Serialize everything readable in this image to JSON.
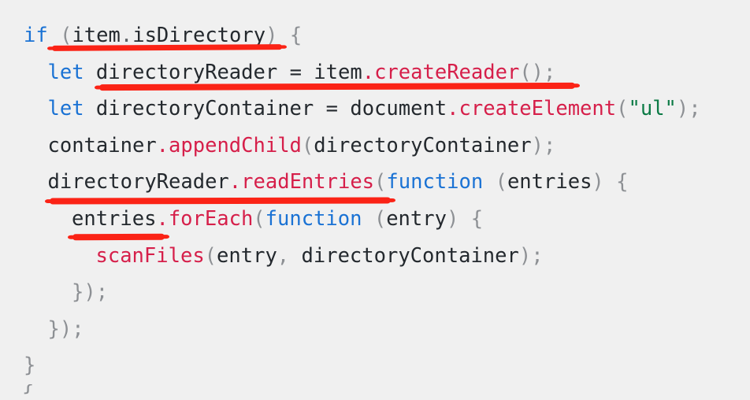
{
  "editor": {
    "background_color": "#f0f0f0",
    "language": "javascript",
    "font_size_px": 25.5
  },
  "theme_colors": {
    "keyword": "#1a72d4",
    "identifier": "#24292e",
    "method": "#d61f4a",
    "punctuation": "#8d9094",
    "string": "#0b7a45",
    "annotation_underline": "#fb2316"
  },
  "code": {
    "lines": [
      {
        "id": "line-1",
        "indent": 0,
        "plain_text": "if (item.isDirectory) {",
        "tokens": [
          {
            "t": "if",
            "k": "kw"
          },
          {
            "t": " ",
            "k": "ws"
          },
          {
            "t": "(",
            "k": "punct"
          },
          {
            "t": "item",
            "k": "ident"
          },
          {
            "t": ".",
            "k": "dot-dim"
          },
          {
            "t": "isDirectory",
            "k": "ident"
          },
          {
            "t": ")",
            "k": "punct"
          },
          {
            "t": " ",
            "k": "ws"
          },
          {
            "t": "{",
            "k": "punct"
          }
        ]
      },
      {
        "id": "line-2",
        "indent": 1,
        "plain_text": "let directoryReader = item.createReader();",
        "tokens": [
          {
            "t": "let",
            "k": "kw"
          },
          {
            "t": " ",
            "k": "ws"
          },
          {
            "t": "directoryReader",
            "k": "ident"
          },
          {
            "t": " ",
            "k": "ws"
          },
          {
            "t": "=",
            "k": "op"
          },
          {
            "t": " ",
            "k": "ws"
          },
          {
            "t": "item",
            "k": "ident"
          },
          {
            "t": ".",
            "k": "dot"
          },
          {
            "t": "createReader",
            "k": "method"
          },
          {
            "t": "(",
            "k": "punct"
          },
          {
            "t": ")",
            "k": "punct"
          },
          {
            "t": ";",
            "k": "punct"
          }
        ]
      },
      {
        "id": "line-3",
        "indent": 1,
        "plain_text": "let directoryContainer = document.createElement(\"ul\");",
        "tokens": [
          {
            "t": "let",
            "k": "kw"
          },
          {
            "t": " ",
            "k": "ws"
          },
          {
            "t": "directoryContainer",
            "k": "ident"
          },
          {
            "t": " ",
            "k": "ws"
          },
          {
            "t": "=",
            "k": "op"
          },
          {
            "t": " ",
            "k": "ws"
          },
          {
            "t": "document",
            "k": "ident"
          },
          {
            "t": ".",
            "k": "dot"
          },
          {
            "t": "createElement",
            "k": "method"
          },
          {
            "t": "(",
            "k": "punct"
          },
          {
            "t": "\"ul\"",
            "k": "str"
          },
          {
            "t": ")",
            "k": "punct"
          },
          {
            "t": ";",
            "k": "punct"
          }
        ]
      },
      {
        "id": "line-4",
        "indent": 1,
        "plain_text": "container.appendChild(directoryContainer);",
        "tokens": [
          {
            "t": "container",
            "k": "ident"
          },
          {
            "t": ".",
            "k": "dot"
          },
          {
            "t": "appendChild",
            "k": "method"
          },
          {
            "t": "(",
            "k": "punct"
          },
          {
            "t": "directoryContainer",
            "k": "ident"
          },
          {
            "t": ")",
            "k": "punct"
          },
          {
            "t": ";",
            "k": "punct"
          }
        ]
      },
      {
        "id": "line-5",
        "indent": 1,
        "plain_text": "directoryReader.readEntries(function (entries) {",
        "tokens": [
          {
            "t": "directoryReader",
            "k": "ident"
          },
          {
            "t": ".",
            "k": "dot"
          },
          {
            "t": "readEntries",
            "k": "method"
          },
          {
            "t": "(",
            "k": "punct"
          },
          {
            "t": "function",
            "k": "kw"
          },
          {
            "t": " ",
            "k": "ws"
          },
          {
            "t": "(",
            "k": "punct"
          },
          {
            "t": "entries",
            "k": "ident"
          },
          {
            "t": ")",
            "k": "punct"
          },
          {
            "t": " ",
            "k": "ws"
          },
          {
            "t": "{",
            "k": "punct"
          }
        ]
      },
      {
        "id": "line-6",
        "indent": 2,
        "plain_text": "entries.forEach(function (entry) {",
        "tokens": [
          {
            "t": "entries",
            "k": "ident"
          },
          {
            "t": ".",
            "k": "dot"
          },
          {
            "t": "forEach",
            "k": "method"
          },
          {
            "t": "(",
            "k": "punct"
          },
          {
            "t": "function",
            "k": "kw"
          },
          {
            "t": " ",
            "k": "ws"
          },
          {
            "t": "(",
            "k": "punct"
          },
          {
            "t": "entry",
            "k": "ident"
          },
          {
            "t": ")",
            "k": "punct"
          },
          {
            "t": " ",
            "k": "ws"
          },
          {
            "t": "{",
            "k": "punct"
          }
        ]
      },
      {
        "id": "line-7",
        "indent": 3,
        "plain_text": "scanFiles(entry, directoryContainer);",
        "tokens": [
          {
            "t": "scanFiles",
            "k": "method"
          },
          {
            "t": "(",
            "k": "punct"
          },
          {
            "t": "entry",
            "k": "ident"
          },
          {
            "t": ",",
            "k": "punct"
          },
          {
            "t": " ",
            "k": "ws"
          },
          {
            "t": "directoryContainer",
            "k": "ident"
          },
          {
            "t": ")",
            "k": "punct"
          },
          {
            "t": ";",
            "k": "punct"
          }
        ]
      },
      {
        "id": "line-8",
        "indent": 2,
        "plain_text": "});",
        "tokens": [
          {
            "t": "}",
            "k": "punct"
          },
          {
            "t": ")",
            "k": "punct"
          },
          {
            "t": ";",
            "k": "punct"
          }
        ]
      },
      {
        "id": "line-9",
        "indent": 1,
        "plain_text": "});",
        "tokens": [
          {
            "t": "}",
            "k": "punct"
          },
          {
            "t": ")",
            "k": "punct"
          },
          {
            "t": ";",
            "k": "punct"
          }
        ]
      },
      {
        "id": "line-10",
        "indent": 0,
        "plain_text": "}",
        "tokens": [
          {
            "t": "}",
            "k": "punct"
          }
        ]
      },
      {
        "id": "line-11",
        "indent": -1,
        "clipped": true,
        "plain_text": "}",
        "tokens": [
          {
            "t": "}",
            "k": "punct"
          }
        ]
      }
    ]
  },
  "annotations": {
    "underlines": [
      {
        "id": "ul-1",
        "target_text": "item.isDirectory",
        "on_line": "line-1",
        "color": "#fb2316"
      },
      {
        "id": "ul-2",
        "target_text": "directoryReader = item.createReader",
        "on_line": "line-2",
        "color": "#fb2316"
      },
      {
        "id": "ul-3",
        "target_text": "directoryReader.readEntries",
        "on_line": "line-5",
        "color": "#fb2316"
      },
      {
        "id": "ul-4",
        "target_text": "entries",
        "on_line": "line-6",
        "color": "#fb2316"
      }
    ]
  }
}
